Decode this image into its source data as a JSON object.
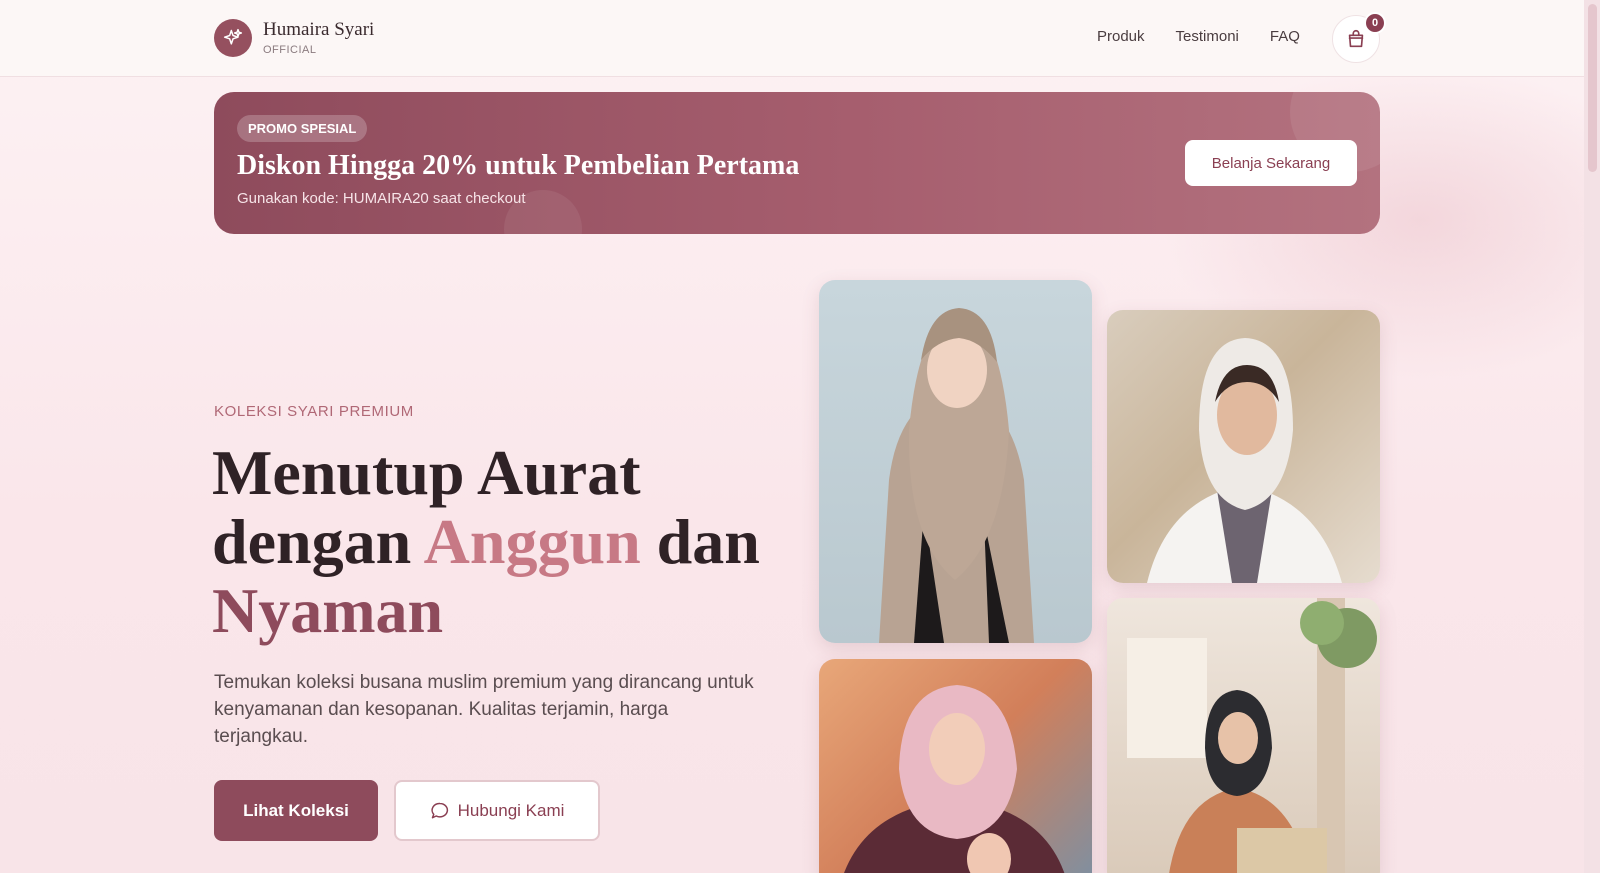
{
  "header": {
    "brand_name": "Humaira Syari",
    "brand_sub": "OFFICIAL",
    "nav": [
      "Produk",
      "Testimoni",
      "FAQ"
    ],
    "cart_count": "0"
  },
  "promo": {
    "badge": "PROMO SPESIAL",
    "title": "Diskon Hingga 20% untuk Pembelian Pertama",
    "subtitle": "Gunakan kode: HUMAIRA20 saat checkout",
    "cta": "Belanja Sekarang"
  },
  "hero": {
    "eyebrow": "KOLEKSI SYARI PREMIUM",
    "headline_1": "Menutup Aurat",
    "headline_2": "dengan ",
    "headline_accent": "Anggun",
    "headline_3": " dan",
    "headline_accent2": "Nyaman",
    "description": "Temukan koleksi busana muslim premium yang dirancang untuk kenyamanan dan kesopanan. Kualitas terjamin, harga terjangkau.",
    "primary_button": "Lihat Koleksi",
    "secondary_button": "Hubungi Kami"
  },
  "colors": {
    "brand": "#8e4b5c",
    "accent": "#c77985",
    "background": "#fae6ea"
  },
  "icons": {
    "logo": "sparkle-icon",
    "cart": "shopping-bag-icon",
    "chat": "chat-bubble-icon"
  }
}
